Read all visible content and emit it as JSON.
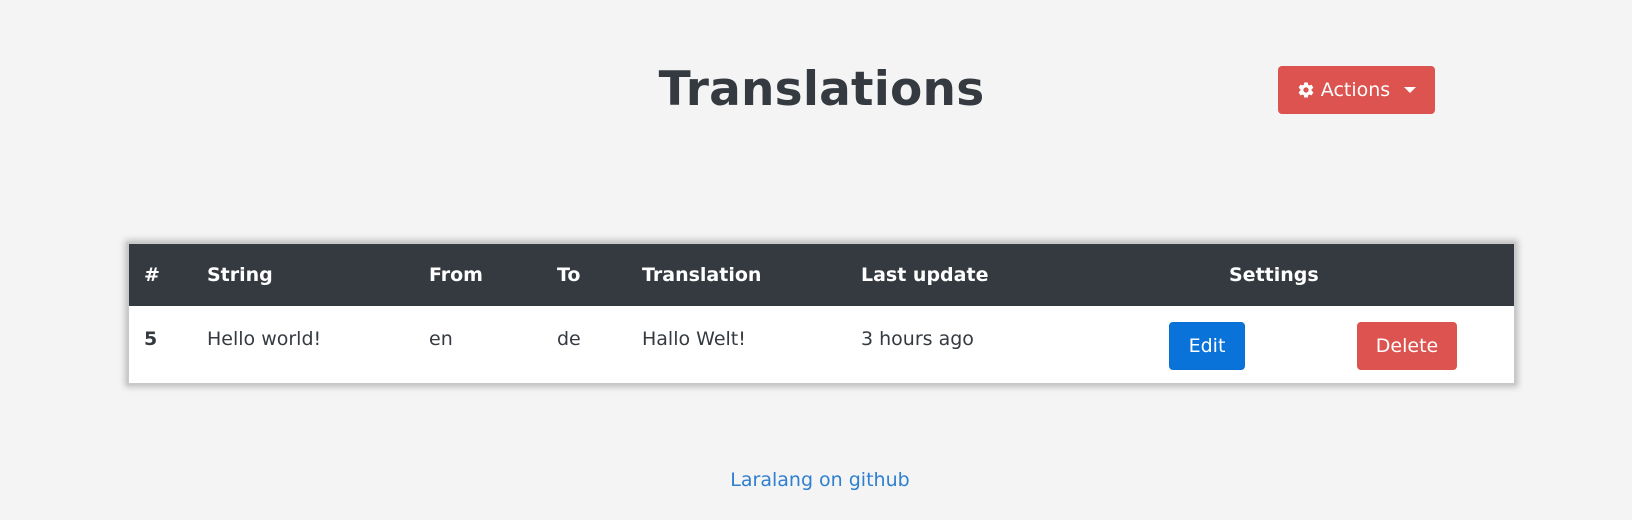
{
  "header": {
    "title": "Translations",
    "actions_label": "Actions",
    "actions_icon": "gear-icon",
    "actions_color": "#d9534f"
  },
  "table": {
    "columns": [
      "#",
      "String",
      "From",
      "To",
      "Translation",
      "Last update",
      "Settings"
    ],
    "rows": [
      {
        "id": "5",
        "string": "Hello world!",
        "from": "en",
        "to": "de",
        "translation": "Hallo Welt!",
        "last_update": "3 hours ago",
        "edit_label": "Edit",
        "delete_label": "Delete"
      }
    ]
  },
  "footer": {
    "link_text": "Laralang on github"
  },
  "colors": {
    "header_bg": "#343a40",
    "edit": "#0275d8",
    "delete": "#d9534f",
    "link": "#2f7fcf"
  }
}
